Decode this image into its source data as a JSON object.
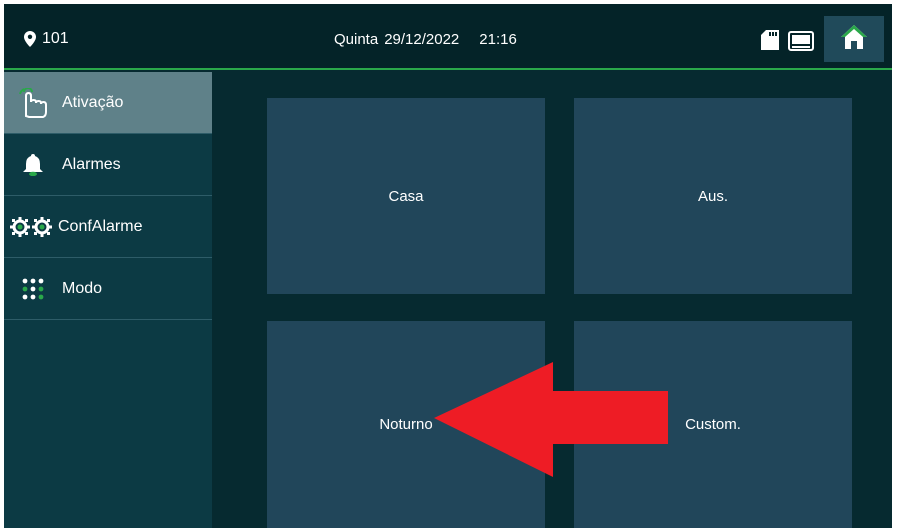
{
  "header": {
    "room_number": "101",
    "day": "Quinta",
    "date": "29/12/2022",
    "time": "21:16"
  },
  "sidebar": {
    "items": [
      {
        "label": "Ativação",
        "icon": "hand-pointer-icon",
        "active": true
      },
      {
        "label": "Alarmes",
        "icon": "bell-icon",
        "active": false
      },
      {
        "label": "ConfAlarme",
        "icon": "gears-icon",
        "active": false
      },
      {
        "label": "Modo",
        "icon": "dots-grid-icon",
        "active": false
      }
    ]
  },
  "modes": [
    {
      "label": "Casa"
    },
    {
      "label": "Aus."
    },
    {
      "label": "Noturno"
    },
    {
      "label": "Custom."
    }
  ],
  "colors": {
    "background": "#062a30",
    "topbar": "#042328",
    "accent": "#2aa84a",
    "tile": "#21465a",
    "sidebar_active": "#5f8189",
    "annotation_arrow": "#ee1c25"
  },
  "annotation": {
    "icon": "red-arrow-icon"
  }
}
